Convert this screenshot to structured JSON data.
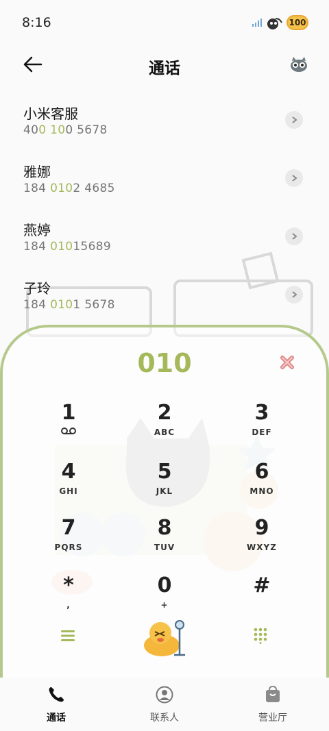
{
  "status": {
    "time": "8:16",
    "battery": "100"
  },
  "header": {
    "title": "通话"
  },
  "contacts": [
    {
      "name": "小米客服",
      "num_pre": "40",
      "num_hl1": "0",
      "num_mid": " ",
      "num_hl2": "10",
      "num_post": "0 5678"
    },
    {
      "name": "雅娜",
      "num_pre": "184 ",
      "num_hl1": "010",
      "num_mid": "",
      "num_hl2": "",
      "num_post": "2 4685"
    },
    {
      "name": "燕婷",
      "num_pre": "184 ",
      "num_hl1": "010",
      "num_mid": "",
      "num_hl2": "",
      "num_post": "15689"
    },
    {
      "name": "子玲",
      "num_pre": "184 ",
      "num_hl1": "010",
      "num_mid": "",
      "num_hl2": "",
      "num_post": "1 5678"
    }
  ],
  "dialpad": {
    "input": "010",
    "keys": [
      {
        "digit": "1",
        "letters": ""
      },
      {
        "digit": "2",
        "letters": "ABC"
      },
      {
        "digit": "3",
        "letters": "DEF"
      },
      {
        "digit": "4",
        "letters": "GHI"
      },
      {
        "digit": "5",
        "letters": "JKL"
      },
      {
        "digit": "6",
        "letters": "MNO"
      },
      {
        "digit": "7",
        "letters": "PQRS"
      },
      {
        "digit": "8",
        "letters": "TUV"
      },
      {
        "digit": "9",
        "letters": "WXYZ"
      },
      {
        "digit": "*",
        "letters": ","
      },
      {
        "digit": "0",
        "letters": "+"
      },
      {
        "digit": "#",
        "letters": ""
      }
    ]
  },
  "nav": [
    {
      "label": "通话",
      "icon": "phone-icon"
    },
    {
      "label": "联系人",
      "icon": "person-icon"
    },
    {
      "label": "营业厅",
      "icon": "shopping-bag-icon"
    }
  ],
  "colors": {
    "accent": "#a3b95a",
    "border": "#b6c98c",
    "delete": "#e08a8a"
  }
}
